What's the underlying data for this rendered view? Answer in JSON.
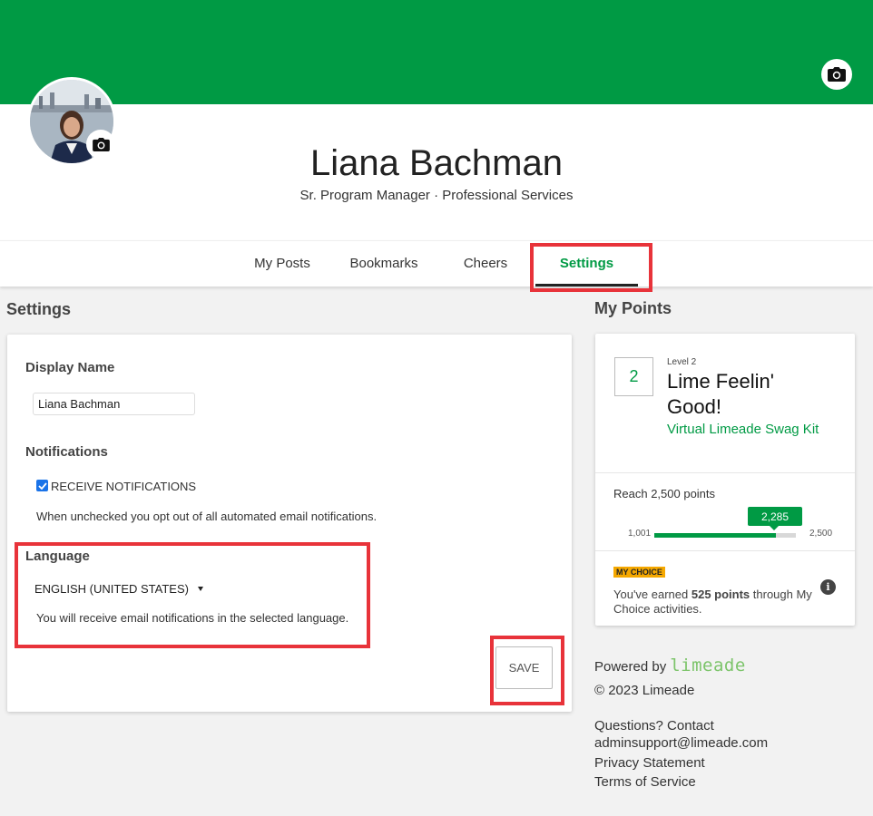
{
  "profile": {
    "name": "Liana Bachman",
    "subtitle": "Sr. Program Manager · Professional Services"
  },
  "tabs": [
    {
      "label": "My Posts"
    },
    {
      "label": "Bookmarks"
    },
    {
      "label": "Cheers"
    },
    {
      "label": "Settings",
      "active": true
    }
  ],
  "settings": {
    "title": "Settings",
    "display_name_label": "Display Name",
    "display_name_value": "Liana Bachman",
    "notifications_label": "Notifications",
    "receive_notifications_label": "RECEIVE NOTIFICATIONS",
    "receive_notifications_checked": true,
    "notifications_help": "When unchecked you opt out of all automated email notifications.",
    "language_label": "Language",
    "language_value": "ENGLISH (UNITED STATES)",
    "language_help": "You will receive email notifications in the selected language.",
    "save_label": "SAVE"
  },
  "points": {
    "title": "My Points",
    "level_number": "2",
    "level_caption": "Level 2",
    "level_name": "Lime Feelin' Good!",
    "reward_link": "Virtual Limeade Swag Kit",
    "reach_text": "Reach 2,500 points",
    "progress_min": "1,001",
    "progress_max": "2,500",
    "progress_current": "2,285",
    "progress_fraction": 0.857,
    "badge": "MY CHOICE",
    "earned_prefix": "You've earned ",
    "earned_points": "525 points",
    "earned_suffix": " through My Choice activities."
  },
  "footer": {
    "powered_by": "Powered by",
    "brand": "limeade",
    "copyright": "© 2023 Limeade",
    "questions": "Questions? Contact",
    "email": "adminsupport@limeade.com",
    "privacy": "Privacy Statement",
    "terms": "Terms of Service"
  },
  "colors": {
    "brand_green": "#009a44",
    "highlight_red": "#e8333a",
    "badge_yellow": "#f5a800"
  },
  "icons": {
    "banner_camera": "camera-icon",
    "avatar_camera": "camera-icon",
    "info": "info-icon",
    "checkbox": "check-icon",
    "dropdown": "caret-down-icon"
  }
}
